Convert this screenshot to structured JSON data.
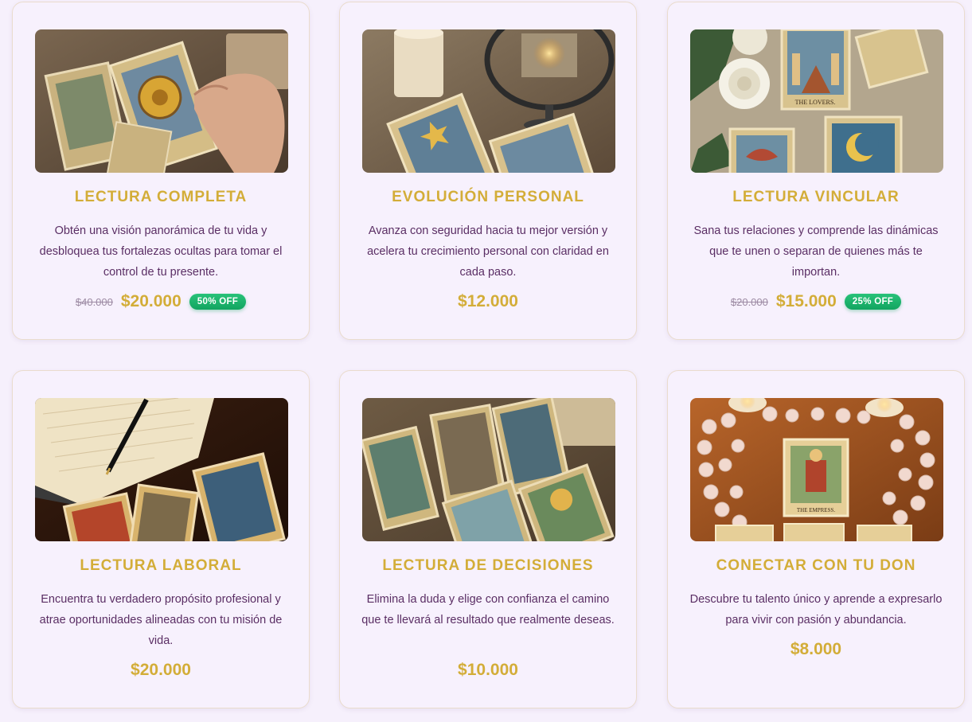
{
  "colors": {
    "accent_gold": "#d3ad38",
    "text_purple": "#5a2e64",
    "badge_green": "#1ab36b",
    "background": "#f6f0fc"
  },
  "cards": [
    {
      "title": "LECTURA COMPLETA",
      "description": "Obtén una visión panorámica de tu vida y desbloquea tus fortalezas ocultas para tomar el control de tu presente.",
      "old_price": "$40.000",
      "price": "$20.000",
      "discount": "50% OFF",
      "image": "tarot-hand-wheel-of-fortune"
    },
    {
      "title": "EVOLUCIÓN PERSONAL",
      "description": "Avanza con seguridad hacia tu mejor versión y acelera tu crecimiento personal con claridad en cada paso.",
      "price": "$12.000",
      "image": "tarot-star-mirror-candle"
    },
    {
      "title": "LECTURA VINCULAR",
      "description": "Sana tus relaciones y comprende las dinámicas que te unen o separan de quienes más te importan.",
      "old_price": "$20.000",
      "price": "$15.000",
      "discount": "25% OFF",
      "image": "tarot-lovers-roses",
      "image_caption": "THE LOVERS."
    },
    {
      "title": "LECTURA LABORAL",
      "description": "Encuentra tu verdadero propósito profesional y atrae oportunidades alineadas con tu misión de vida.",
      "price": "$20.000",
      "image": "tarot-notebook-pen"
    },
    {
      "title": "LECTURA DE DECISIONES",
      "description": "Elimina la duda y elige con confianza el camino que te llevará al resultado que realmente deseas.",
      "price": "$10.000",
      "image": "tarot-spread-table"
    },
    {
      "title": "CONECTAR CON TU DON",
      "description": "Descubre tu talento único y aprende a expresarlo para vivir con pasión y abundancia.",
      "price": "$8.000",
      "image": "tarot-empress-crystals",
      "image_caption": "THE EMPRESS."
    }
  ]
}
